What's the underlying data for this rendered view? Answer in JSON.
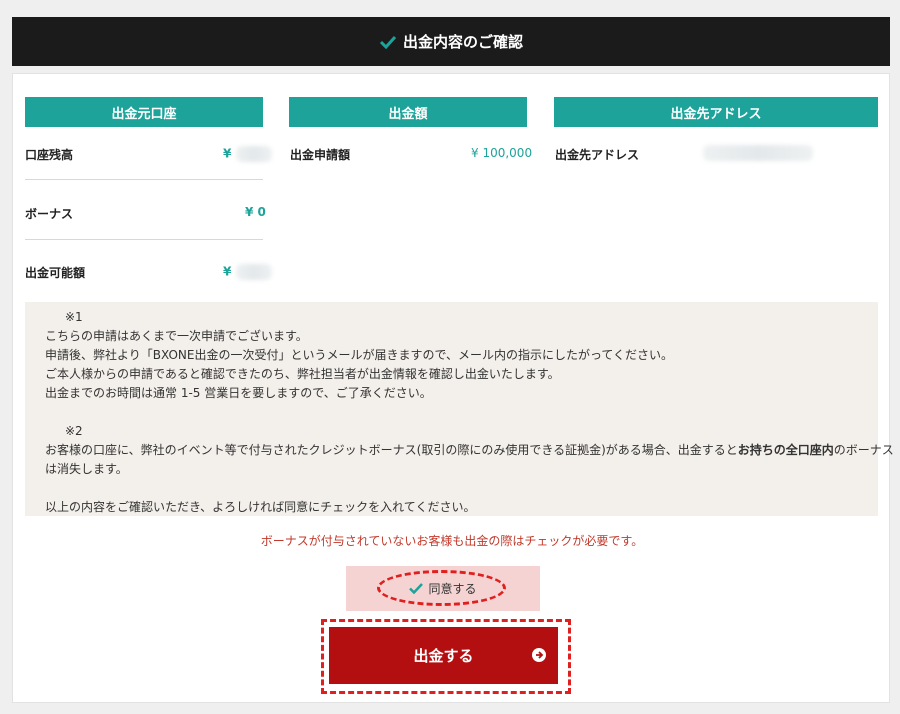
{
  "header": {
    "title": "出金内容のご確認"
  },
  "source_account": {
    "heading": "出金元口座",
    "rows": [
      {
        "label": "口座残高",
        "value": "¥"
      },
      {
        "label": "ボーナス",
        "value": "¥ 0"
      },
      {
        "label": "出金可能額",
        "value": "¥"
      }
    ]
  },
  "amount": {
    "heading": "出金額",
    "label": "出金申請額",
    "value": "¥ 100,000"
  },
  "destination": {
    "heading": "出金先アドレス",
    "label": "出金先アドレス"
  },
  "notes": {
    "note1_mark": "※1",
    "note1_lines": [
      "こちらの申請はあくまで一次申請でございます。",
      "申請後、弊社より「BXONE出金の一次受付」というメールが届きますので、メール内の指示にしたがってください。",
      "ご本人様からの申請であると確認できたのち、弊社担当者が出金情報を確認し出金いたします。",
      "出金までのお時間は通常 1-5 営業日を要しますので、ご了承ください。"
    ],
    "note2_mark": "※2",
    "note2_pre": "お客様の口座に、弊社のイベント等で付与されたクレジットボーナス(取引の際にのみ使用できる証拠金)がある場合、出金すると",
    "note2_bold": "お持ちの全口座内",
    "note2_post": "のボーナス",
    "note2_line2": "は消失します。",
    "closing": "以上の内容をご確認いただき、よろしければ同意にチェックを入れてください。"
  },
  "warning": "ボーナスが付与されていないお客様も出金の際はチェックが必要です。",
  "agree": {
    "label": "同意する",
    "checked": true
  },
  "submit": {
    "label": "出金する"
  },
  "colors": {
    "accent": "#1da39a",
    "header_bg": "#1b1b1b",
    "submit_bg": "#b30f10",
    "warning": "#c0392b"
  }
}
